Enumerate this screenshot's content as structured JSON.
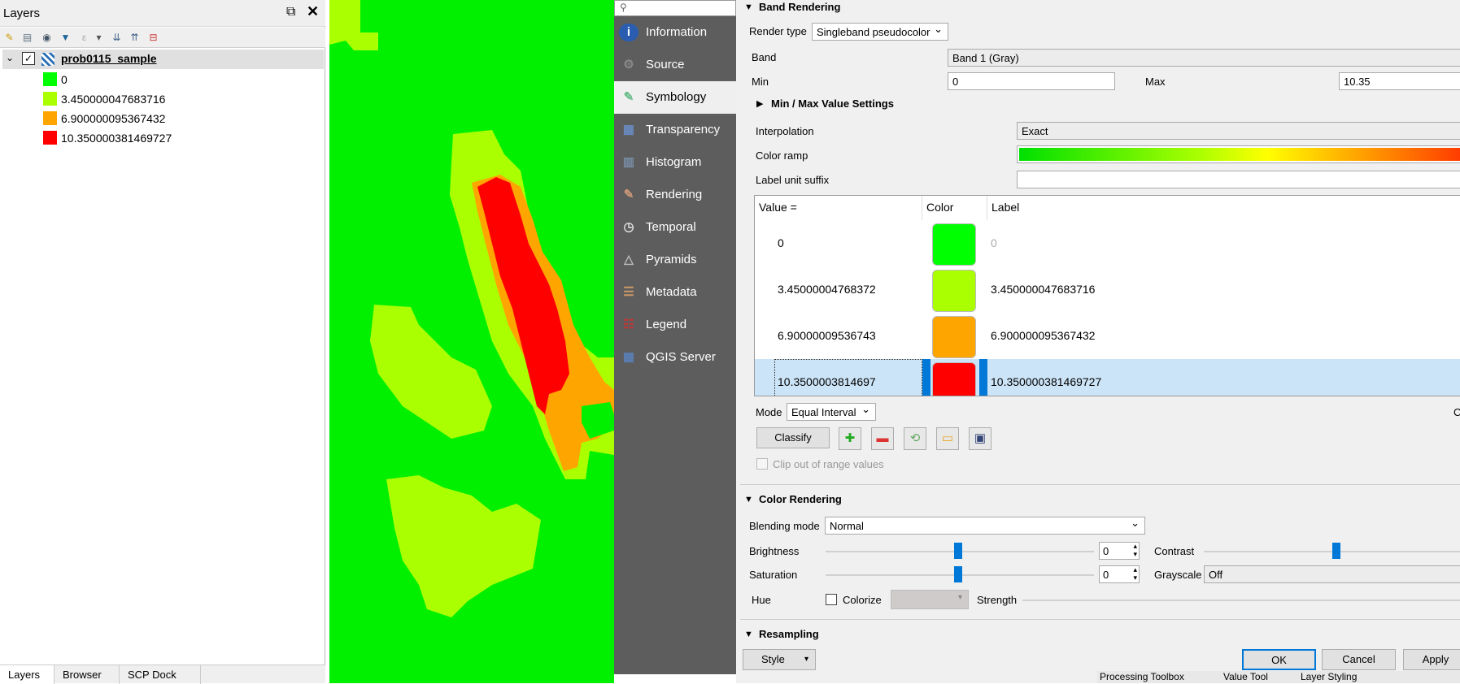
{
  "layers_panel": {
    "title": "Layers",
    "layer_name": "prob0115_sample",
    "legend": [
      {
        "label": "0",
        "color": "#00ff00"
      },
      {
        "label": "3.450000047683716",
        "color": "#aaff00"
      },
      {
        "label": "6.900000095367432",
        "color": "#ffa500"
      },
      {
        "label": "10.350000381469727",
        "color": "#ff0000"
      }
    ],
    "bottom_tabs": [
      "Layers",
      "Browser",
      "SCP Dock"
    ]
  },
  "bottom_bar_tabs": [
    "Processing Toolbox",
    "Value Tool",
    "Layer Styling"
  ],
  "sidebar": {
    "items": [
      {
        "label": "Information",
        "icon": "info-icon"
      },
      {
        "label": "Source",
        "icon": "source-icon"
      },
      {
        "label": "Symbology",
        "icon": "symbology-icon"
      },
      {
        "label": "Transparency",
        "icon": "transparency-icon"
      },
      {
        "label": "Histogram",
        "icon": "histogram-icon"
      },
      {
        "label": "Rendering",
        "icon": "rendering-icon"
      },
      {
        "label": "Temporal",
        "icon": "clock-icon"
      },
      {
        "label": "Pyramids",
        "icon": "pyramids-icon"
      },
      {
        "label": "Metadata",
        "icon": "metadata-icon"
      },
      {
        "label": "Legend",
        "icon": "legend-icon"
      },
      {
        "label": "QGIS Server",
        "icon": "server-icon"
      }
    ],
    "active_index": 2
  },
  "band_rendering": {
    "title": "Band Rendering",
    "render_type_label": "Render type",
    "render_type": "Singleband pseudocolor",
    "band_label": "Band",
    "band": "Band 1 (Gray)",
    "min_label": "Min",
    "min": "0",
    "max_label": "Max",
    "max": "10.35",
    "minmax_settings": "Min / Max Value Settings",
    "interpolation_label": "Interpolation",
    "interpolation": "Exact",
    "color_ramp_label": "Color ramp",
    "label_suffix_label": "Label unit suffix",
    "table_headers": [
      "Value =",
      "Color",
      "Label"
    ],
    "rows": [
      {
        "value": "0",
        "color": "#00ff00",
        "label": "0"
      },
      {
        "value": "3.45000004768372",
        "color": "#aaff00",
        "label": "3.450000047683716"
      },
      {
        "value": "6.90000009536743",
        "color": "#ffa500",
        "label": "6.900000095367432"
      },
      {
        "value": "10.3500003814697",
        "color": "#ff0000",
        "label": "10.350000381469727"
      }
    ],
    "mode_label": "Mode",
    "mode": "Equal Interval",
    "classes_label": "Cl",
    "classify": "Classify",
    "clip_label": "Clip out of range values"
  },
  "color_rendering": {
    "title": "Color Rendering",
    "blending_label": "Blending mode",
    "blending": "Normal",
    "brightness_label": "Brightness",
    "brightness": "0",
    "contrast_label": "Contrast",
    "saturation_label": "Saturation",
    "saturation": "0",
    "grayscale_label": "Grayscale",
    "grayscale": "Off",
    "hue_label": "Hue",
    "colorize_label": "Colorize",
    "strength_label": "Strength"
  },
  "resampling": {
    "title": "Resampling"
  },
  "footer": {
    "style": "Style",
    "ok": "OK",
    "cancel": "Cancel",
    "apply": "Apply"
  }
}
